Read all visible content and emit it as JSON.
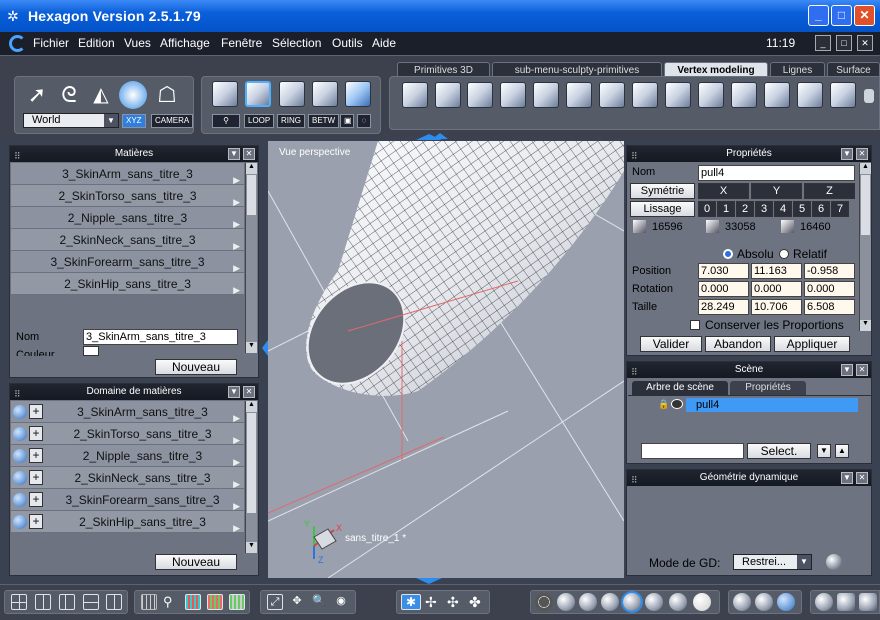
{
  "window": {
    "title": "Hexagon Version 2.5.1.79",
    "clock": "11:19"
  },
  "menubar": {
    "items": [
      "Fichier",
      "Edition",
      "Vues",
      "Affichage",
      "Fenêtre",
      "Sélection",
      "Outils",
      "Aide"
    ]
  },
  "toolbar": {
    "world_select": "World",
    "xyz": "XYZ",
    "camera": "CAMERA",
    "selection_modes": [
      "LOOP",
      "RING",
      "BETW"
    ],
    "tabs": [
      "Primitives 3D",
      "sub-menu-sculpty-primitives",
      "Vertex modeling",
      "Lignes",
      "Surface"
    ],
    "active_tab": "Vertex modeling"
  },
  "matieres": {
    "title": "Matières",
    "items": [
      "3_SkinArm_sans_titre_3",
      "2_SkinTorso_sans_titre_3",
      "2_Nipple_sans_titre_3",
      "2_SkinNeck_sans_titre_3",
      "3_SkinForearm_sans_titre_3",
      "2_SkinHip_sans_titre_3"
    ],
    "nom_label": "Nom",
    "nom_value": "3_SkinArm_sans_titre_3",
    "couleur_label": "Couleur",
    "nouveau": "Nouveau"
  },
  "domaine": {
    "title": "Domaine de matières",
    "items": [
      "3_SkinArm_sans_titre_3",
      "2_SkinTorso_sans_titre_3",
      "2_Nipple_sans_titre_3",
      "2_SkinNeck_sans_titre_3",
      "3_SkinForearm_sans_titre_3",
      "2_SkinHip_sans_titre_3"
    ],
    "nouveau": "Nouveau"
  },
  "viewport": {
    "label": "Vue perspective",
    "object_label": "sans_titre_1 *",
    "axes": {
      "x": "X",
      "y": "Y",
      "z": "Z"
    }
  },
  "proprietes": {
    "title": "Propriétés",
    "nom_label": "Nom",
    "nom_value": "pull4",
    "symetrie": "Symétrie",
    "axes": [
      "X",
      "Y",
      "Z"
    ],
    "lissage": "Lissage",
    "lissage_levels": [
      "0",
      "1",
      "2",
      "3",
      "4",
      "5",
      "6",
      "7"
    ],
    "stats": [
      "16596",
      "33058",
      "16460"
    ],
    "absolu": "Absolu",
    "relatif": "Relatif",
    "position_label": "Position",
    "position": [
      "7.030",
      "11.163",
      "-0.958"
    ],
    "rotation_label": "Rotation",
    "rotation": [
      "0.000",
      "0.000",
      "0.000"
    ],
    "taille_label": "Taille",
    "taille": [
      "28.249",
      "10.706",
      "6.508"
    ],
    "conserver": "Conserver les Proportions",
    "valider": "Valider",
    "abandon": "Abandon",
    "appliquer": "Appliquer"
  },
  "scene": {
    "title": "Scène",
    "tabs": [
      "Arbre de scène",
      "Propriétés"
    ],
    "item": "pull4",
    "select": "Select."
  },
  "geometrie": {
    "title": "Géométrie dynamique",
    "mode_label": "Mode de GD:",
    "mode_value": "Restrei..."
  }
}
